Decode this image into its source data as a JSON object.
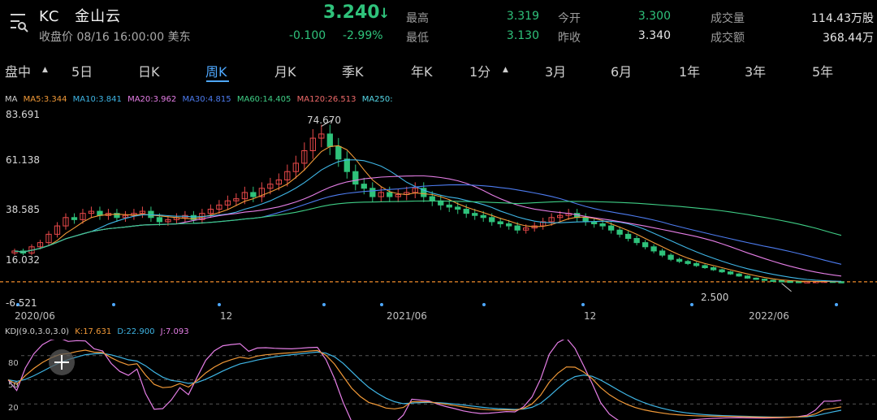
{
  "header": {
    "symbol": "KC",
    "name": "金山云",
    "close_line": "收盘价 08/16 16:00:00 美东",
    "price": "3.240",
    "change": "-0.100",
    "change_pct": "-2.99%",
    "direction_icon": "arrow-down-icon",
    "quotes": [
      {
        "label": "最高",
        "value": "3.319",
        "color": "green"
      },
      {
        "label": "最低",
        "value": "3.130",
        "color": "green"
      },
      {
        "label": "今开",
        "value": "3.300",
        "color": "green"
      },
      {
        "label": "昨收",
        "value": "3.340",
        "color": "white"
      },
      {
        "label": "成交量",
        "value": "114.43万股",
        "color": "white"
      },
      {
        "label": "成交额",
        "value": "368.44万",
        "color": "white"
      }
    ]
  },
  "tabs": [
    {
      "label": "盘中",
      "has_caret": true
    },
    {
      "label": "5日"
    },
    {
      "label": "日K"
    },
    {
      "label": "周K",
      "active": true
    },
    {
      "label": "月K"
    },
    {
      "label": "季K"
    },
    {
      "label": "年K"
    },
    {
      "label": "1分",
      "has_caret": true
    },
    {
      "label": "3月"
    },
    {
      "label": "6月"
    },
    {
      "label": "1年"
    },
    {
      "label": "3年"
    },
    {
      "label": "5年"
    }
  ],
  "colors": {
    "up": "#e8494a",
    "down": "#2fc27b",
    "accent": "#4ea8ff",
    "background": "#000000"
  },
  "chart_data": [
    {
      "type": "candlestick",
      "period": "weekly",
      "x_tick_labels": [
        "2020/06",
        "12",
        "2021/06",
        "12",
        "2022/06"
      ],
      "y_tick_labels": [
        "83.691",
        "61.138",
        "38.585",
        "16.032",
        "-6.521"
      ],
      "ylim": [
        -6.521,
        83.691
      ],
      "max_marker": "74.670",
      "min_marker": "2.500",
      "current_price": 3.24,
      "ma_legend": [
        {
          "label": "MA",
          "color": "#d0d0d0"
        },
        {
          "label": "MA5:3.344",
          "color": "#f29a38"
        },
        {
          "label": "MA10:3.841",
          "color": "#3fb6e6"
        },
        {
          "label": "MA20:3.962",
          "color": "#e57ee6"
        },
        {
          "label": "MA30:4.815",
          "color": "#4d7cf0"
        },
        {
          "label": "MA60:14.405",
          "color": "#3fce86"
        },
        {
          "label": "MA120:26.513",
          "color": "#f06a6a"
        },
        {
          "label": "MA250:",
          "color": "#56d8e8"
        }
      ],
      "series_close": [
        18,
        17,
        20,
        22,
        26,
        30,
        34,
        33,
        36,
        37,
        35,
        36,
        34,
        35,
        36,
        37,
        34,
        32,
        33,
        34,
        35,
        33,
        36,
        38,
        40,
        42,
        43,
        46,
        44,
        48,
        50,
        52,
        56,
        60,
        66,
        72,
        74,
        68,
        62,
        56,
        50,
        48,
        44,
        46,
        44,
        45,
        46,
        48,
        44,
        42,
        40,
        39,
        38,
        36,
        35,
        34,
        32,
        31,
        30,
        28,
        29,
        30,
        32,
        34,
        35,
        36,
        34,
        32,
        31,
        30,
        28,
        26,
        24,
        22,
        20,
        18,
        16,
        14,
        13,
        12,
        11,
        10,
        9,
        8,
        7,
        6,
        5,
        4.5,
        4,
        3.8,
        3.5,
        3.4,
        3.3,
        3.3,
        3.4,
        3.5,
        3.3,
        3.24
      ]
    },
    {
      "type": "line",
      "title": "KDJ(9.0,3.0,3.0)",
      "series": [
        {
          "name": "K:17.631",
          "color": "#f29a38"
        },
        {
          "name": "D:22.900",
          "color": "#3fb6e6"
        },
        {
          "name": "J:7.093",
          "color": "#e57ee6"
        }
      ],
      "y_tick_labels": [
        "80",
        "50",
        "20"
      ],
      "ylim": [
        0,
        100
      ]
    }
  ]
}
